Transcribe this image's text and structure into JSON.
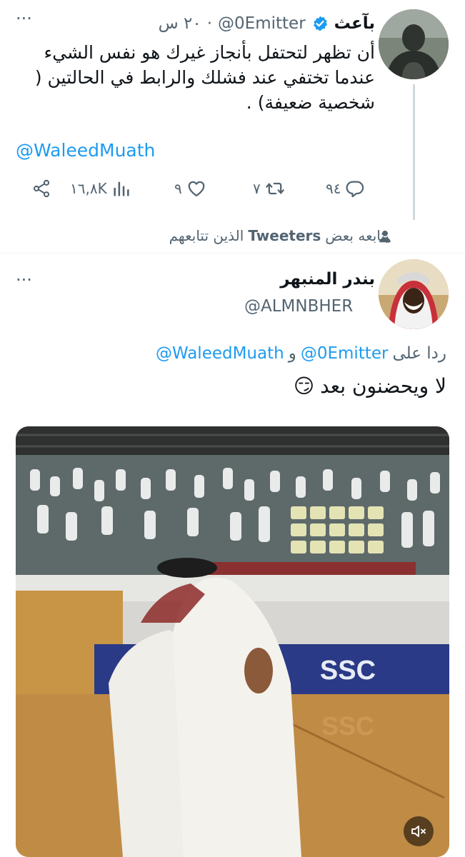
{
  "tweet1": {
    "name": "بآعث",
    "handle": "@0Emitter",
    "time": "٢٠ س",
    "text": "أن تظهر لتحتفل بأنجاز غيرك هو نفس الشيء عندما تختفي عند فشلك والرابط في الحالتين ( شخصية ضعيفة) .",
    "mention": "@WaleedMuath",
    "stats": {
      "views": "١٦,٨K",
      "likes": "٩",
      "retweets": "٧",
      "replies": "٩٤"
    }
  },
  "context": {
    "text_prefix": "يتابعه بعض",
    "text_bold": "Tweeters",
    "text_suffix": "الذين تتابعهم"
  },
  "tweet2": {
    "name": "بندر المنبهر",
    "handle": "@ALMNBHER",
    "reply_prefix": "ردا على",
    "reply_to_1": "@0Emitter",
    "reply_and": "و",
    "reply_to_2": "@WaleedMuath",
    "text": "لا ويحضنون بعد",
    "emoji": "😏",
    "video": {
      "banner_text": "SSC",
      "floor_text": "SSC"
    }
  },
  "colors": {
    "accent": "#1d9bf0",
    "verified": "#1d9bf0",
    "secondary": "#536471"
  }
}
